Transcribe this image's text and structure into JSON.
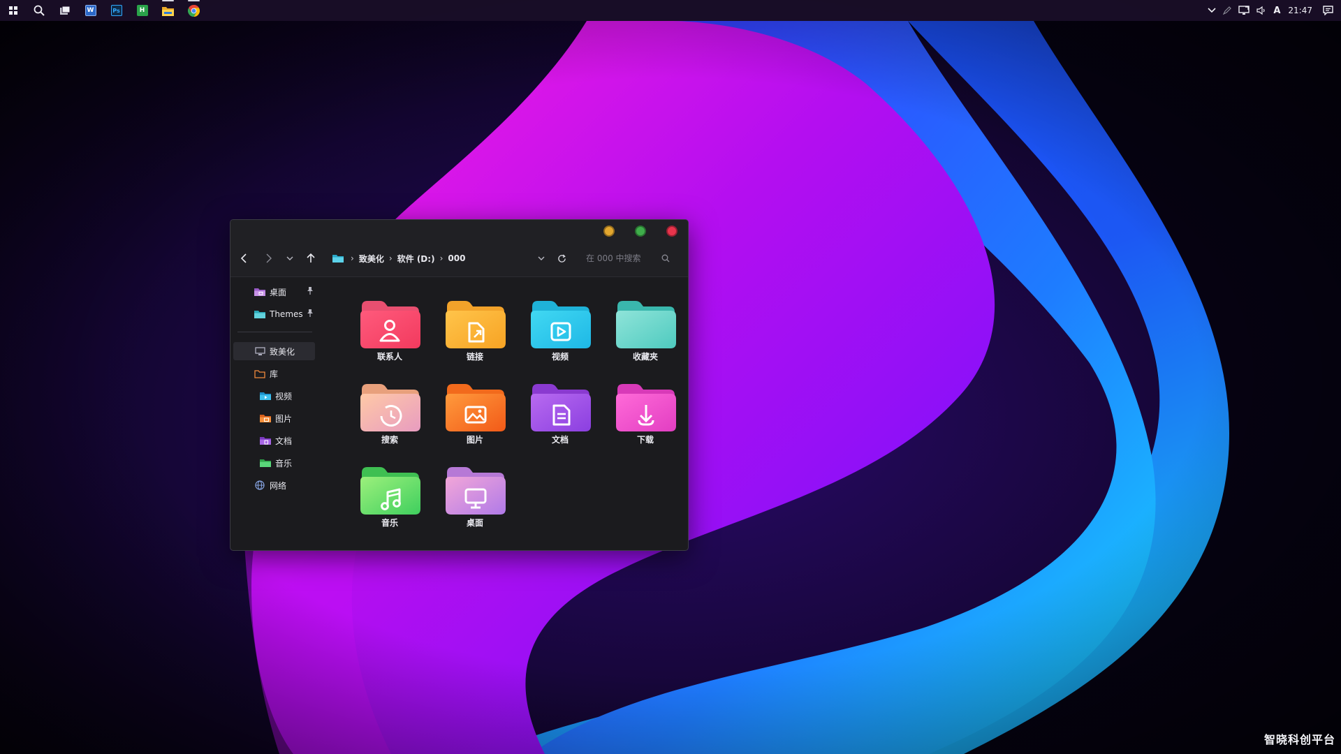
{
  "taskbar": {
    "apps": [
      {
        "id": "start",
        "icon": "windows-start-icon"
      },
      {
        "id": "search",
        "icon": "search-icon"
      },
      {
        "id": "task-view",
        "icon": "task-view-icon"
      },
      {
        "id": "word",
        "icon": "word-app-icon",
        "letter": "W",
        "color": "#2b68c8",
        "active": false
      },
      {
        "id": "photoshop",
        "icon": "photoshop-app-icon",
        "letter": "Ps",
        "color": "#0e2a48",
        "active": false
      },
      {
        "id": "hbuilder",
        "icon": "hbuilder-app-icon",
        "letter": "H",
        "color": "#2aa34a",
        "active": false
      },
      {
        "id": "file-explorer",
        "icon": "file-explorer-icon",
        "active": true
      },
      {
        "id": "chrome",
        "icon": "chrome-icon",
        "active": true
      }
    ],
    "tray": {
      "clock": "21:47",
      "ime": "A"
    }
  },
  "window": {
    "breadcrumb": [
      "致美化",
      "软件 (D:)",
      "000"
    ],
    "search_placeholder": "在 000 中搜索",
    "controls": {
      "minimize": "#e3a72f",
      "maximize": "#3fae4b",
      "close": "#e8344c"
    }
  },
  "sidebar": {
    "pinned": [
      {
        "label": "桌面",
        "icon": "desktop-folder-icon",
        "color": "#b87ad8"
      },
      {
        "label": "Themes",
        "icon": "folder-icon",
        "color": "#4cc8c8"
      }
    ],
    "tree": [
      {
        "label": "致美化",
        "icon": "this-pc-icon",
        "indent": 0,
        "selected": true
      },
      {
        "label": "库",
        "icon": "library-icon",
        "indent": 0
      },
      {
        "label": "视频",
        "icon": "videos-folder-icon",
        "indent": 1,
        "color": "#2fb8e8"
      },
      {
        "label": "图片",
        "icon": "pictures-folder-icon",
        "indent": 1,
        "color": "#f0822c"
      },
      {
        "label": "文档",
        "icon": "documents-folder-icon",
        "indent": 1,
        "color": "#9a4ad8"
      },
      {
        "label": "音乐",
        "icon": "music-folder-icon",
        "indent": 1,
        "color": "#4cc86a"
      },
      {
        "label": "网络",
        "icon": "network-icon",
        "indent": 0
      }
    ]
  },
  "folders": [
    {
      "label": "联系人",
      "icon": "contacts-icon",
      "back": "#e84f70",
      "front1": "#ff5a7c",
      "front2": "#f23a5e",
      "glyph": "person"
    },
    {
      "label": "链接",
      "icon": "links-icon",
      "back": "#f2a22a",
      "front1": "#ffc44a",
      "front2": "#f7a324",
      "glyph": "link"
    },
    {
      "label": "视频",
      "icon": "videos-icon",
      "back": "#1fb2d8",
      "front1": "#41d8f2",
      "front2": "#1eb8e6",
      "glyph": "play"
    },
    {
      "label": "收藏夹",
      "icon": "favorites-icon",
      "back": "#3ab7ad",
      "front1": "#8fe4d9",
      "front2": "#4ecabf",
      "glyph": "none"
    },
    {
      "label": "搜索",
      "icon": "searches-icon",
      "back": "#e8a07c",
      "front1": "#ffc9a6",
      "front2": "#e89cc0",
      "glyph": "clock"
    },
    {
      "label": "图片",
      "icon": "pictures-icon",
      "back": "#f26a1c",
      "front1": "#ff9a3c",
      "front2": "#f25a18",
      "glyph": "picture"
    },
    {
      "label": "文档",
      "icon": "documents-icon",
      "back": "#8a3ad0",
      "front1": "#b86af0",
      "front2": "#8b3fe0",
      "glyph": "document"
    },
    {
      "label": "下载",
      "icon": "downloads-icon",
      "back": "#d83ab8",
      "front1": "#ff6ad8",
      "front2": "#e23ec2",
      "glyph": "download"
    },
    {
      "label": "音乐",
      "icon": "music-icon",
      "back": "#3fbf52",
      "front1": "#9cf07c",
      "front2": "#3fcf5e",
      "glyph": "music"
    },
    {
      "label": "桌面",
      "icon": "desktop-icon",
      "back": "#b679d6",
      "front1": "#f2a6d8",
      "front2": "#b07ae8",
      "glyph": "monitor"
    }
  ],
  "watermark": "智晓科创平台"
}
